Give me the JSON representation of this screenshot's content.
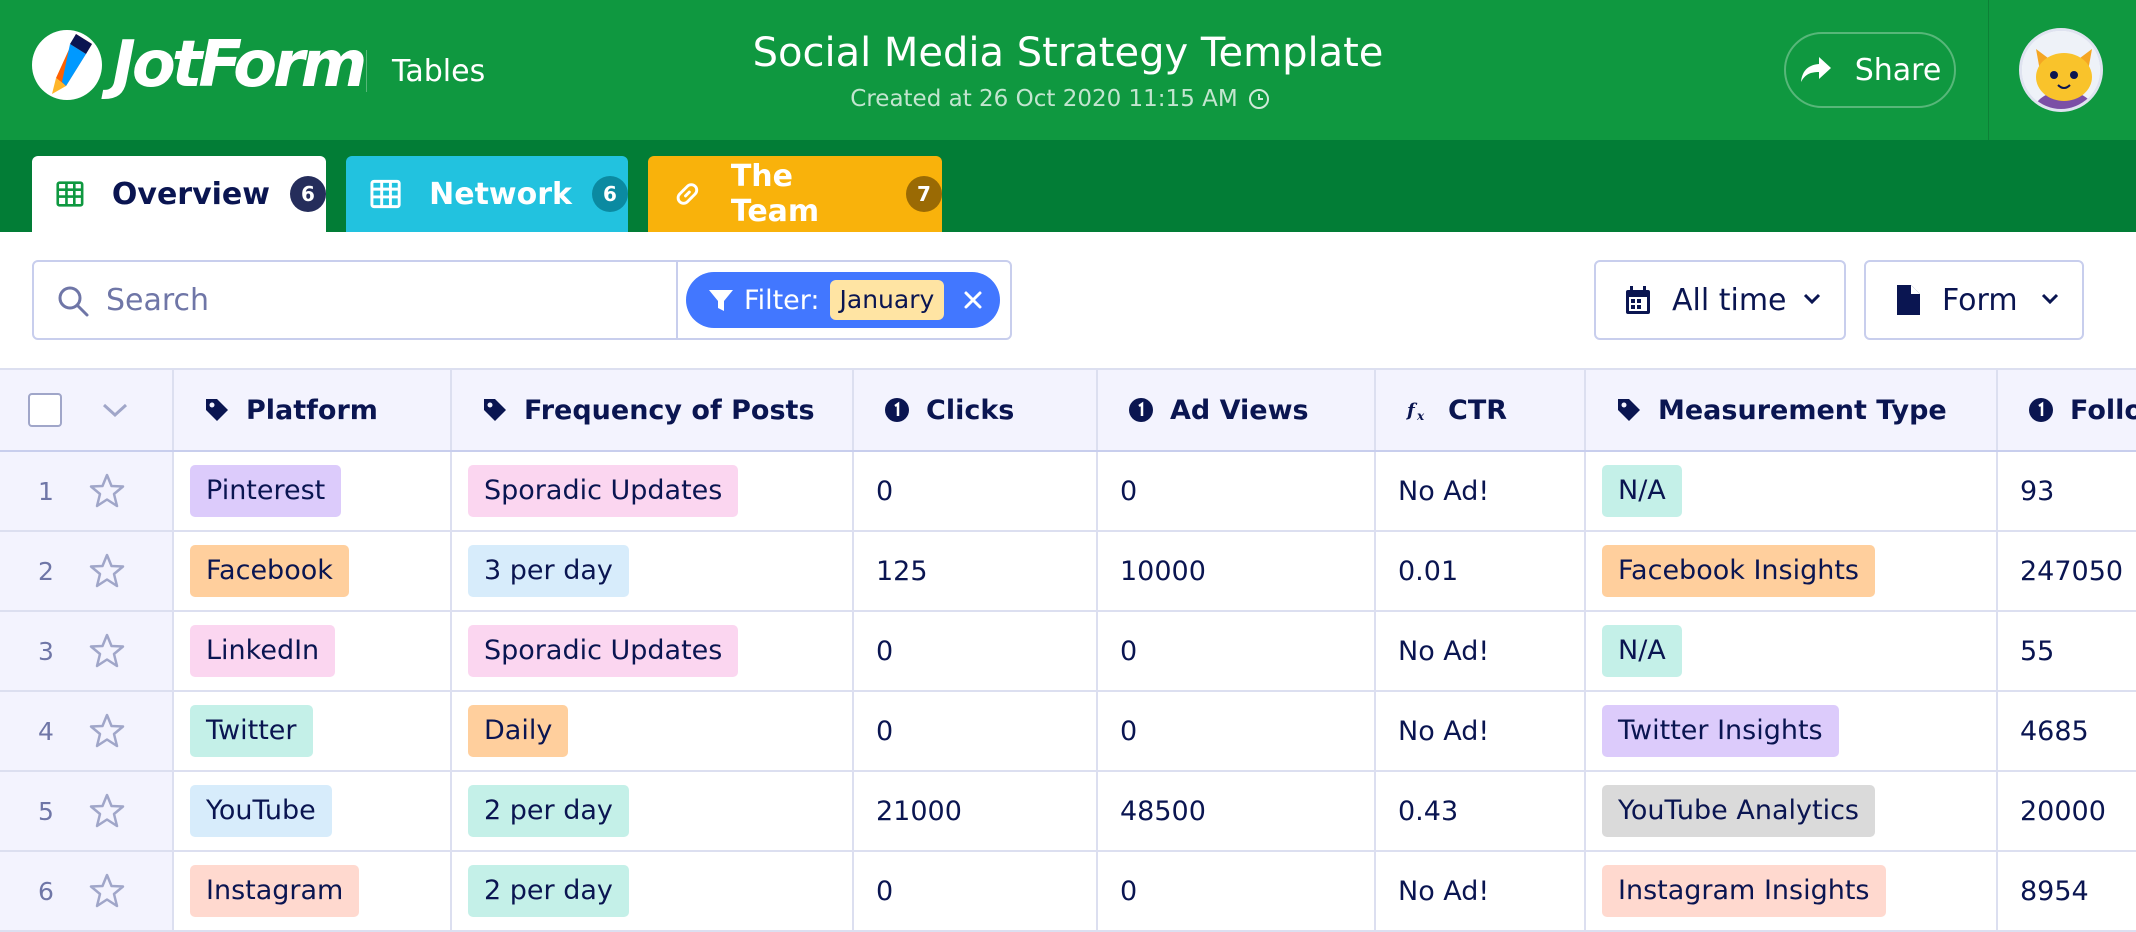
{
  "header": {
    "logo_text": "JotForm",
    "section": "Tables",
    "title": "Social Media Strategy Template",
    "subtitle": "Created at 26 Oct 2020 11:15 AM",
    "share_label": "Share"
  },
  "tabs": [
    {
      "label": "Overview",
      "count": "6",
      "icon": "grid-icon"
    },
    {
      "label": "Network",
      "count": "6",
      "icon": "grid-icon"
    },
    {
      "label": "The Team",
      "count": "7",
      "icon": "link-icon"
    }
  ],
  "toolbar": {
    "search_placeholder": "Search",
    "filter_label": "Filter:",
    "filter_value": "January",
    "time_label": "All time",
    "form_label": "Form"
  },
  "table": {
    "columns": [
      "Platform",
      "Frequency of Posts",
      "Clicks",
      "Ad Views",
      "CTR",
      "Measurement Type",
      "Follo"
    ],
    "column_icons": [
      "tag-icon",
      "tag-icon",
      "number-icon",
      "number-icon",
      "formula-icon",
      "tag-icon",
      "number-icon"
    ],
    "rows": [
      {
        "n": "1",
        "platform": "Pinterest",
        "frequency": "Sporadic Updates",
        "clicks": "0",
        "ad_views": "0",
        "ctr": "No Ad!",
        "measurement": "N/A",
        "followers": "93"
      },
      {
        "n": "2",
        "platform": "Facebook",
        "frequency": "3 per day",
        "clicks": "125",
        "ad_views": "10000",
        "ctr": "0.01",
        "measurement": "Facebook Insights",
        "followers": "247050"
      },
      {
        "n": "3",
        "platform": "LinkedIn",
        "frequency": "Sporadic Updates",
        "clicks": "0",
        "ad_views": "0",
        "ctr": "No Ad!",
        "measurement": "N/A",
        "followers": "55"
      },
      {
        "n": "4",
        "platform": "Twitter",
        "frequency": "Daily",
        "clicks": "0",
        "ad_views": "0",
        "ctr": "No Ad!",
        "measurement": "Twitter Insights",
        "followers": "4685"
      },
      {
        "n": "5",
        "platform": "YouTube",
        "frequency": "2 per day",
        "clicks": "21000",
        "ad_views": "48500",
        "ctr": "0.43",
        "measurement": "YouTube Analytics",
        "followers": "20000"
      },
      {
        "n": "6",
        "platform": "Instagram",
        "frequency": "2 per day",
        "clicks": "0",
        "ad_views": "0",
        "ctr": "No Ad!",
        "measurement": "Instagram Insights",
        "followers": "8954"
      }
    ]
  },
  "colors": {
    "header_green": "#0f9840",
    "tabbar_green": "#027d36",
    "network_tab": "#22c2df",
    "team_tab": "#f9b20b",
    "filter_blue": "#4277ff",
    "tag_purple": "#dccbfb",
    "tag_orange": "#ffcf9d",
    "tag_pink": "#fbd6f0",
    "tag_teal": "#c4f0e8",
    "tag_blue": "#d7ecfb",
    "tag_salmon": "#ffd9cf",
    "tag_gray": "#dadada"
  }
}
